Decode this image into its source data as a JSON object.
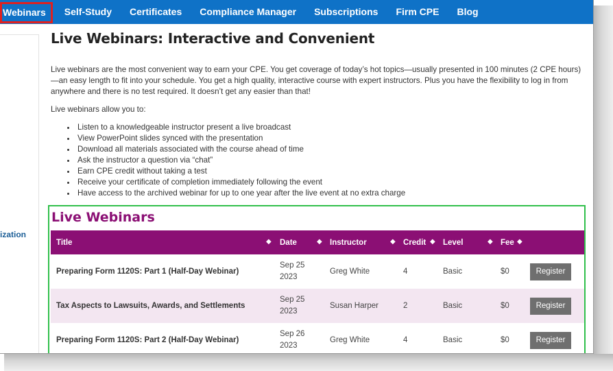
{
  "nav": {
    "items": [
      {
        "label": "Webinars"
      },
      {
        "label": "Self-Study"
      },
      {
        "label": "Certificates"
      },
      {
        "label": "Compliance Manager"
      },
      {
        "label": "Subscriptions"
      },
      {
        "label": "Firm CPE"
      },
      {
        "label": "Blog"
      }
    ]
  },
  "sidebar": {
    "link_text": "ization"
  },
  "page": {
    "title": "Live Webinars: Interactive and Convenient",
    "intro": "Live webinars are the most convenient way to earn your CPE. You get coverage of today’s hot topics—usually presented in 100 minutes (2 CPE hours)—an easy length to fit into your schedule.  You get a high quality, interactive course with expert instructors.  Plus you have the flexibility to log in from anywhere and there is no test required.  It doesn’t get any easier than that!",
    "allow_text": "Live webinars allow you to:",
    "benefits": [
      "Listen to a knowledgeable instructor present a live broadcast",
      "View PowerPoint slides synced with the presentation",
      "Download all materials associated with the course ahead of time",
      "Ask the instructor a question via “chat”",
      "Earn CPE credit without taking a test",
      "Receive your certificate of completion immediately following the event",
      "Have access to the archived webinar for up to one year after the live event at no extra charge"
    ]
  },
  "webinars": {
    "heading": "Live Webinars",
    "columns": [
      "Title",
      "Date",
      "Instructor",
      "Credit",
      "Level",
      "Fee"
    ],
    "sort_icon": "◆",
    "rows": [
      {
        "title": "Preparing Form 1120S: Part 1 (Half-Day Webinar)",
        "date_line1": "Sep 25",
        "date_line2": "2023",
        "instructor": "Greg White",
        "credit": "4",
        "level": "Basic",
        "fee": "$0",
        "button": "Register"
      },
      {
        "title": "Tax Aspects to Lawsuits, Awards, and Settlements",
        "date_line1": "Sep 25",
        "date_line2": "2023",
        "instructor": "Susan Harper",
        "credit": "2",
        "level": "Basic",
        "fee": "$0",
        "button": "Register"
      },
      {
        "title": "Preparing Form 1120S: Part 2 (Half-Day Webinar)",
        "date_line1": "Sep 26",
        "date_line2": "2023",
        "instructor": "Greg White",
        "credit": "4",
        "level": "Basic",
        "fee": "$0",
        "button": "Register"
      }
    ]
  },
  "colors": {
    "nav_bg": "#0f72c7",
    "active_outline": "#e0201f",
    "brand_purple": "#8b0f74",
    "highlight_green": "#2fbf4a",
    "row_alt": "#f3e6f1",
    "button_gray": "#6f6f6f"
  }
}
